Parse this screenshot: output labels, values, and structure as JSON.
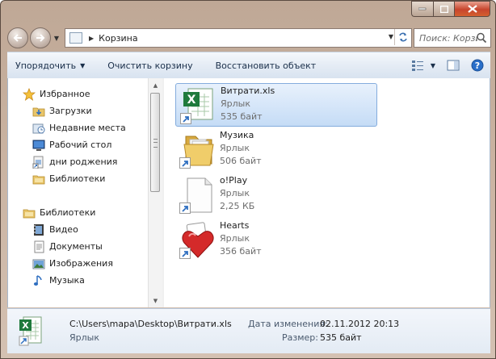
{
  "window": {
    "caption_buttons": [
      "minimize",
      "maximize",
      "close"
    ]
  },
  "address": {
    "location": "Корзина",
    "search_placeholder": "Поиск: Корзина"
  },
  "toolbar": {
    "organize_label": "Упорядочить",
    "empty_bin_label": "Очистить корзину",
    "restore_label": "Восстановить объект"
  },
  "nav": {
    "favorites_label": "Избранное",
    "favorites": [
      {
        "label": "Загрузки",
        "icon": "downloads-folder-icon"
      },
      {
        "label": "Недавние места",
        "icon": "recent-places-icon"
      },
      {
        "label": "Рабочий стол",
        "icon": "desktop-icon"
      },
      {
        "label": "дни роджения",
        "icon": "folder-shortcut-icon"
      },
      {
        "label": "Библиотеки",
        "icon": "libraries-icon"
      }
    ],
    "libraries_label": "Библиотеки",
    "libraries": [
      {
        "label": "Видео",
        "icon": "video-library-icon"
      },
      {
        "label": "Документы",
        "icon": "documents-library-icon"
      },
      {
        "label": "Изображения",
        "icon": "pictures-library-icon"
      },
      {
        "label": "Музыка",
        "icon": "music-library-icon"
      }
    ]
  },
  "files": [
    {
      "name": "Витрати.xls",
      "type": "Ярлык",
      "size": "535 байт",
      "icon": "excel-shortcut-icon",
      "selected": true
    },
    {
      "name": "Музика",
      "type": "Ярлык",
      "size": "506 байт",
      "icon": "folder-shortcut-icon",
      "selected": false
    },
    {
      "name": "o!Play",
      "type": "Ярлык",
      "size": "2,25 КБ",
      "icon": "blank-file-shortcut-icon",
      "selected": false
    },
    {
      "name": "Hearts",
      "type": "Ярлык",
      "size": "356 байт",
      "icon": "hearts-game-shortcut-icon",
      "selected": false
    }
  ],
  "details": {
    "path": "C:\\Users\\mapa\\Desktop\\Витрати.xls",
    "type": "Ярлык",
    "modified_label": "Дата изменения:",
    "modified_value": "02.11.2012 20:13",
    "size_label": "Размер:",
    "size_value": "535 байт"
  },
  "colors": {
    "frame": "#c9b2a0",
    "toolbar_text": "#1a2f4a",
    "selection": "#c5dcf6",
    "close_button": "#c7452d"
  }
}
